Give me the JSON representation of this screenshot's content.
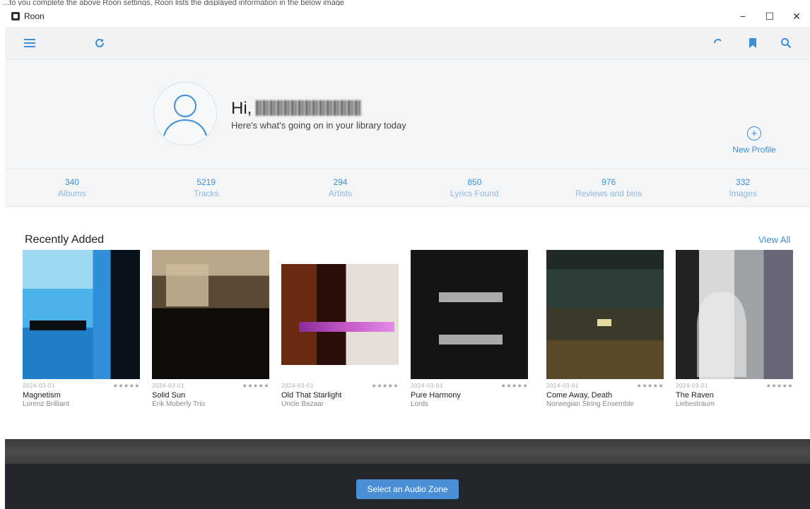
{
  "caption": "...to you complete the above Roon settings, Roon lists the displayed information in the below image",
  "window": {
    "title": "Roon",
    "minimize": "−",
    "maximize": "☐",
    "close": "✕"
  },
  "toolbar": {
    "menu_icon": "menu-icon",
    "refresh_icon": "refresh-icon",
    "loading_icon": "loading-icon",
    "bookmark_icon": "bookmark-icon",
    "search_icon": "search-icon"
  },
  "profile": {
    "greeting": "Hi,",
    "subtitle": "Here's what's going on in your library today",
    "new_profile_label": "New Profile"
  },
  "stats": [
    {
      "value": "340",
      "label": "Albums"
    },
    {
      "value": "5219",
      "label": "Tracks"
    },
    {
      "value": "294",
      "label": "Artists"
    },
    {
      "value": "850",
      "label": "Lyrics Found"
    },
    {
      "value": "976",
      "label": "Reviews and bios"
    },
    {
      "value": "332",
      "label": "Images"
    }
  ],
  "recent": {
    "title": "Recently Added",
    "view_all": "View All",
    "albums": [
      {
        "date": "2024-03-01",
        "stars": "★★★★★",
        "title": "Magnetism",
        "artist": "Lorenz Brilliant"
      },
      {
        "date": "2024-03-01",
        "stars": "★★★★★",
        "title": "Solid Sun",
        "artist": "Erik Moberly Trio"
      },
      {
        "date": "2024-03-01",
        "stars": "★★★★★",
        "title": "Old That Starlight",
        "artist": "Uncle Bazaar"
      },
      {
        "date": "2024-03-01",
        "stars": "★★★★★",
        "title": "Pure Harmony",
        "artist": "Lords"
      },
      {
        "date": "2024-03-01",
        "stars": "★★★★★",
        "title": "Come Away, Death",
        "artist": "Norwegian String Ensemble"
      },
      {
        "date": "2024-03-01",
        "stars": "★★★★★",
        "title": "The Raven",
        "artist": "Liebestraum"
      }
    ]
  },
  "footer": {
    "zone_button": "Select an Audio Zone"
  }
}
